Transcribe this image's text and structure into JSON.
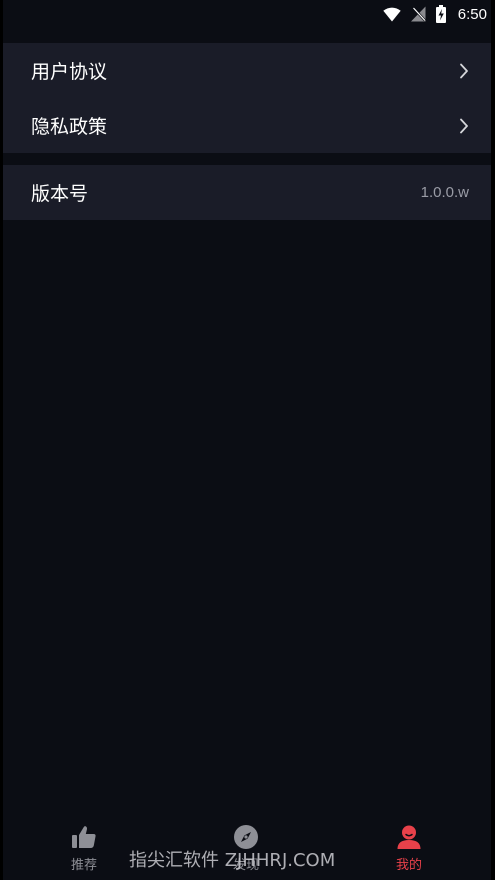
{
  "status_bar": {
    "time": "6:50",
    "icons": [
      "wifi-icon",
      "signal-off-icon",
      "battery-charging-icon"
    ]
  },
  "settings": {
    "group1": [
      {
        "label": "用户协议",
        "icon": "chevron-right-icon"
      },
      {
        "label": "隐私政策",
        "icon": "chevron-right-icon"
      }
    ],
    "version": {
      "label": "版本号",
      "value": "1.0.0.w"
    }
  },
  "tabbar": {
    "tabs": [
      {
        "label": "推荐",
        "icon": "thumbs-up-icon",
        "active": false
      },
      {
        "label": "发现",
        "icon": "compass-icon",
        "active": false
      },
      {
        "label": "我的",
        "icon": "user-icon",
        "active": true
      }
    ]
  },
  "watermark": "指尖汇软件 ZJHHRJ.COM",
  "colors": {
    "background": "#0b0d14",
    "card": "#1a1c28",
    "accent": "#e8414a",
    "inactive": "#8e8f96",
    "text": "#ffffff"
  }
}
